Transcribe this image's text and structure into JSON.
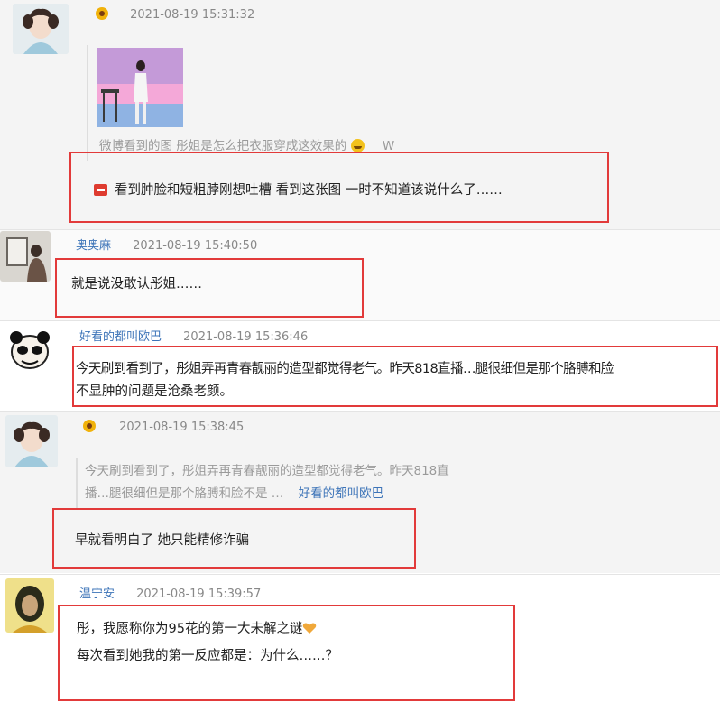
{
  "comments": [
    {
      "time": "2021-08-19 15:31:32",
      "quote_text": "微博看到的图 彤姐是怎么把衣服穿成这效果的",
      "quote_suffix": "W",
      "reply_text": "看到肿脸和短粗脖刚想吐槽 看到这张图 一时不知道该说什么了……"
    },
    {
      "user": "奥奥麻",
      "time": "2021-08-19 15:40:50",
      "text": "就是说没敢认彤姐……"
    },
    {
      "user": "好看的都叫欧巴",
      "time": "2021-08-19 15:36:46",
      "text_line1": "今天刷到看到了，彤姐弄再青春靓丽的造型都觉得老气。昨天818直播…腿很细但是那个胳膊和脸",
      "text_line2": "不显肿的问题是沧桑老颜。"
    },
    {
      "time": "2021-08-19 15:38:45",
      "quote_line1": "今天刷到看到了，彤姐弄再青春靓丽的造型都觉得老气。昨天818直",
      "quote_line2": "播…腿很细但是那个胳膊和脸不是 …",
      "quote_link": "好看的都叫欧巴",
      "reply_text": "早就看明白了 她只能精修诈骗"
    },
    {
      "user": "温宁安",
      "time": "2021-08-19 15:39:57",
      "text_line1": "彤，我愿称你为95花的第一大未解之谜",
      "text_line2": "每次看到她我的第一反应都是：为什么……？"
    }
  ],
  "icons": {
    "badge": "flower-badge-icon",
    "reply_marker": "red-minus-icon",
    "heart": "orange-heart-icon",
    "emoji": "laughing-emoji-icon"
  },
  "colors": {
    "highlight_box": "#e23a3a",
    "username": "#3d74b8",
    "timestamp": "#888888"
  }
}
